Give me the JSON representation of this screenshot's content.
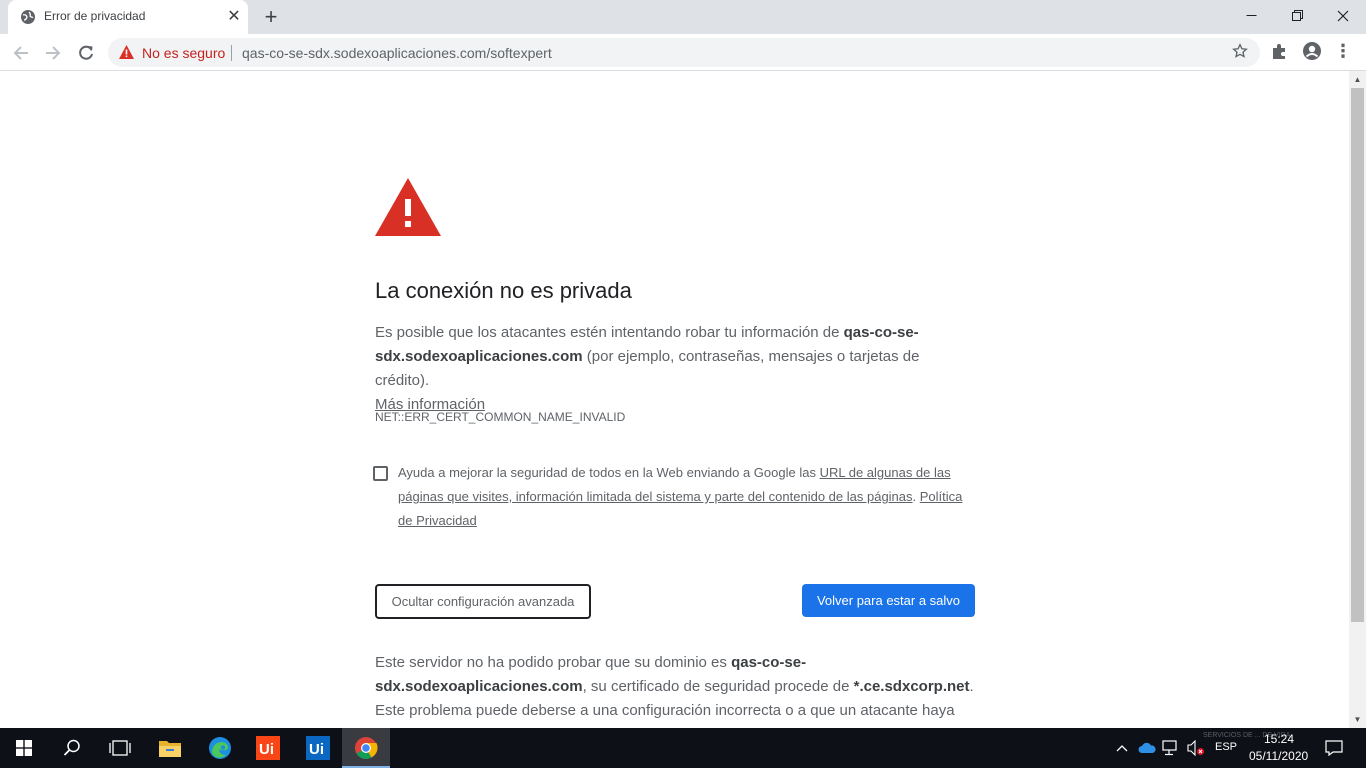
{
  "browser": {
    "tab_title": "Error de privacidad",
    "tab_close": "✕",
    "new_tab": "+",
    "not_secure_label": "No es seguro",
    "url": "qas-co-se-sdx.sodexoaplicaciones.com/softexpert"
  },
  "page": {
    "heading": "La conexión no es privada",
    "p1_pre": "Es posible que los atacantes estén intentando robar tu información de ",
    "p1_domain": "qas-co-se-sdx.sodexoaplicaciones.com",
    "p1_post": " (por ejemplo, contraseñas, mensajes o tarjetas de crédito).",
    "more_info": "Más información",
    "error_code": "NET::ERR_CERT_COMMON_NAME_INVALID",
    "checkbox_pre": "Ayuda a mejorar la seguridad de todos en la Web enviando a Google las ",
    "checkbox_link1": "URL de algunas de las páginas que visites, información limitada del sistema y parte del contenido de las páginas",
    "checkbox_mid": ". ",
    "checkbox_link2": "Política de Privacidad",
    "advanced_button": "Ocultar configuración avanzada",
    "safe_button": "Volver para estar a salvo",
    "p2_pre": "Este servidor no ha podido probar que su dominio es ",
    "p2_domain": "qas-co-se-sdx.sodexoaplicaciones.com",
    "p2_mid": ", su certificado de seguridad procede de ",
    "p2_cert": "*.ce.sdxcorp.net",
    "p2_post": ". Este problema puede deberse a una configuración incorrecta o a que un atacante haya"
  },
  "taskbar": {
    "time": "15:24",
    "date": "05/11/2020",
    "language": "ESP",
    "watermark": "SERVICIOS DE ... DE VIDA"
  },
  "colors": {
    "danger": "#d93025",
    "primary": "#1a73e8",
    "not_secure": "#c5221f"
  }
}
